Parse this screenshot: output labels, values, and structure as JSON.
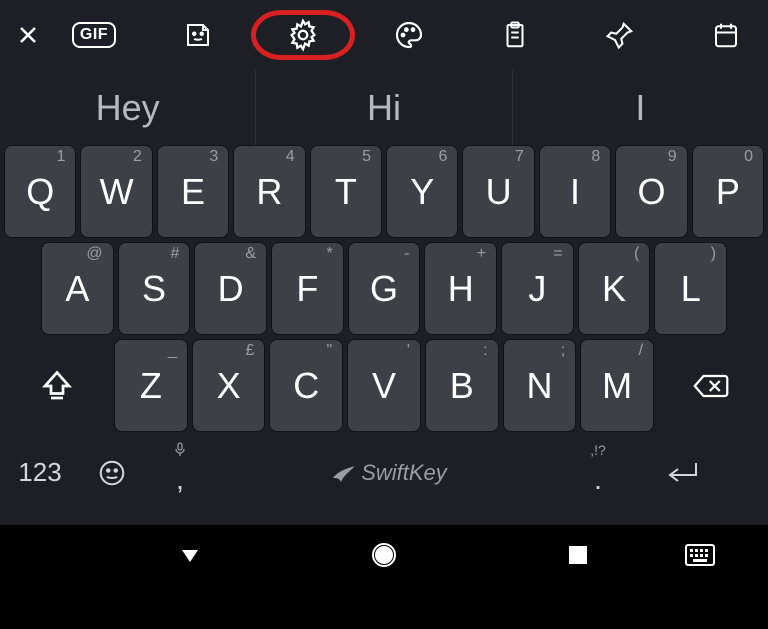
{
  "toolbar": {
    "gif_label": "GIF",
    "highlighted": "settings"
  },
  "suggestions": [
    "Hey",
    "Hi",
    "I"
  ],
  "rows": {
    "r1": [
      {
        "m": "Q",
        "h": "1"
      },
      {
        "m": "W",
        "h": "2"
      },
      {
        "m": "E",
        "h": "3"
      },
      {
        "m": "R",
        "h": "4"
      },
      {
        "m": "T",
        "h": "5"
      },
      {
        "m": "Y",
        "h": "6"
      },
      {
        "m": "U",
        "h": "7"
      },
      {
        "m": "I",
        "h": "8"
      },
      {
        "m": "O",
        "h": "9"
      },
      {
        "m": "P",
        "h": "0"
      }
    ],
    "r2": [
      {
        "m": "A",
        "h": "@"
      },
      {
        "m": "S",
        "h": "#"
      },
      {
        "m": "D",
        "h": "&"
      },
      {
        "m": "F",
        "h": "*"
      },
      {
        "m": "G",
        "h": "-"
      },
      {
        "m": "H",
        "h": "+"
      },
      {
        "m": "J",
        "h": "="
      },
      {
        "m": "K",
        "h": "("
      },
      {
        "m": "L",
        "h": ")"
      }
    ],
    "r3": [
      {
        "m": "Z",
        "h": "_"
      },
      {
        "m": "X",
        "h": "£"
      },
      {
        "m": "C",
        "h": "\""
      },
      {
        "m": "V",
        "h": "'"
      },
      {
        "m": "B",
        "h": ":"
      },
      {
        "m": "N",
        "h": ";"
      },
      {
        "m": "M",
        "h": "/"
      }
    ]
  },
  "bottom": {
    "numeric_label": "123",
    "comma": {
      "sym": ",",
      "hint": "mic"
    },
    "period": {
      "sym": ".",
      "hint": ",!?"
    },
    "space_brand": "SwiftKey"
  }
}
